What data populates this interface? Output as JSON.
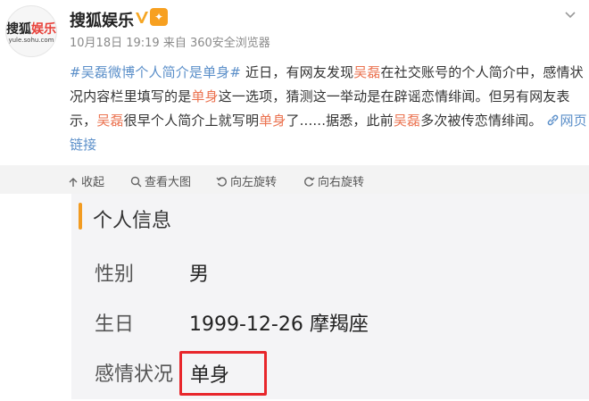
{
  "colors": {
    "link_blue": "#5b8fc9",
    "highlight_orange": "#eb7350",
    "accent_orange": "#f29b21",
    "box_red": "#e8262b",
    "toolbar_bg": "#f3f3f3",
    "card_bg": "#f4f4f6"
  },
  "post": {
    "avatar": {
      "logo_a": "搜狐",
      "logo_b": "娱乐",
      "url": "yule.sohu.com"
    },
    "author": "搜狐娱乐",
    "verified_icon": "verified-v-icon",
    "badge_icon": "member-badge-icon",
    "more_icon": "chevron-down-icon",
    "meta": "10月18日 19:19 来自 360安全浏览器",
    "content": {
      "tag": "#吴磊微博个人简介是单身#",
      "t1": " 近日，有网友发现",
      "hl1": "吴磊",
      "t2": "在社交账号的个人简介中，感情状况内容栏里填写的是",
      "hl2": "单身",
      "t3": "这一选项，猜测这一举动是在辟谣恋情绯闻。但另有网友表示，",
      "hl3": "吴磊",
      "t4": "很早个人简介上就写明",
      "hl4": "单身",
      "t5": "了......据悉，此前",
      "hl5": "吴磊",
      "t6": "多次被传恋情绯闻。",
      "link_text": "网页链接",
      "link_icon": "link-icon"
    }
  },
  "actions": {
    "collapse": "收起",
    "view_large": "查看大图",
    "rotate_left": "向左旋转",
    "rotate_right": "向右旋转"
  },
  "card": {
    "title": "个人信息",
    "rows": [
      {
        "label": "性别",
        "value": "男"
      },
      {
        "label": "生日",
        "value": "1999-12-26  摩羯座"
      },
      {
        "label": "感情状况",
        "value": "单身"
      }
    ]
  }
}
